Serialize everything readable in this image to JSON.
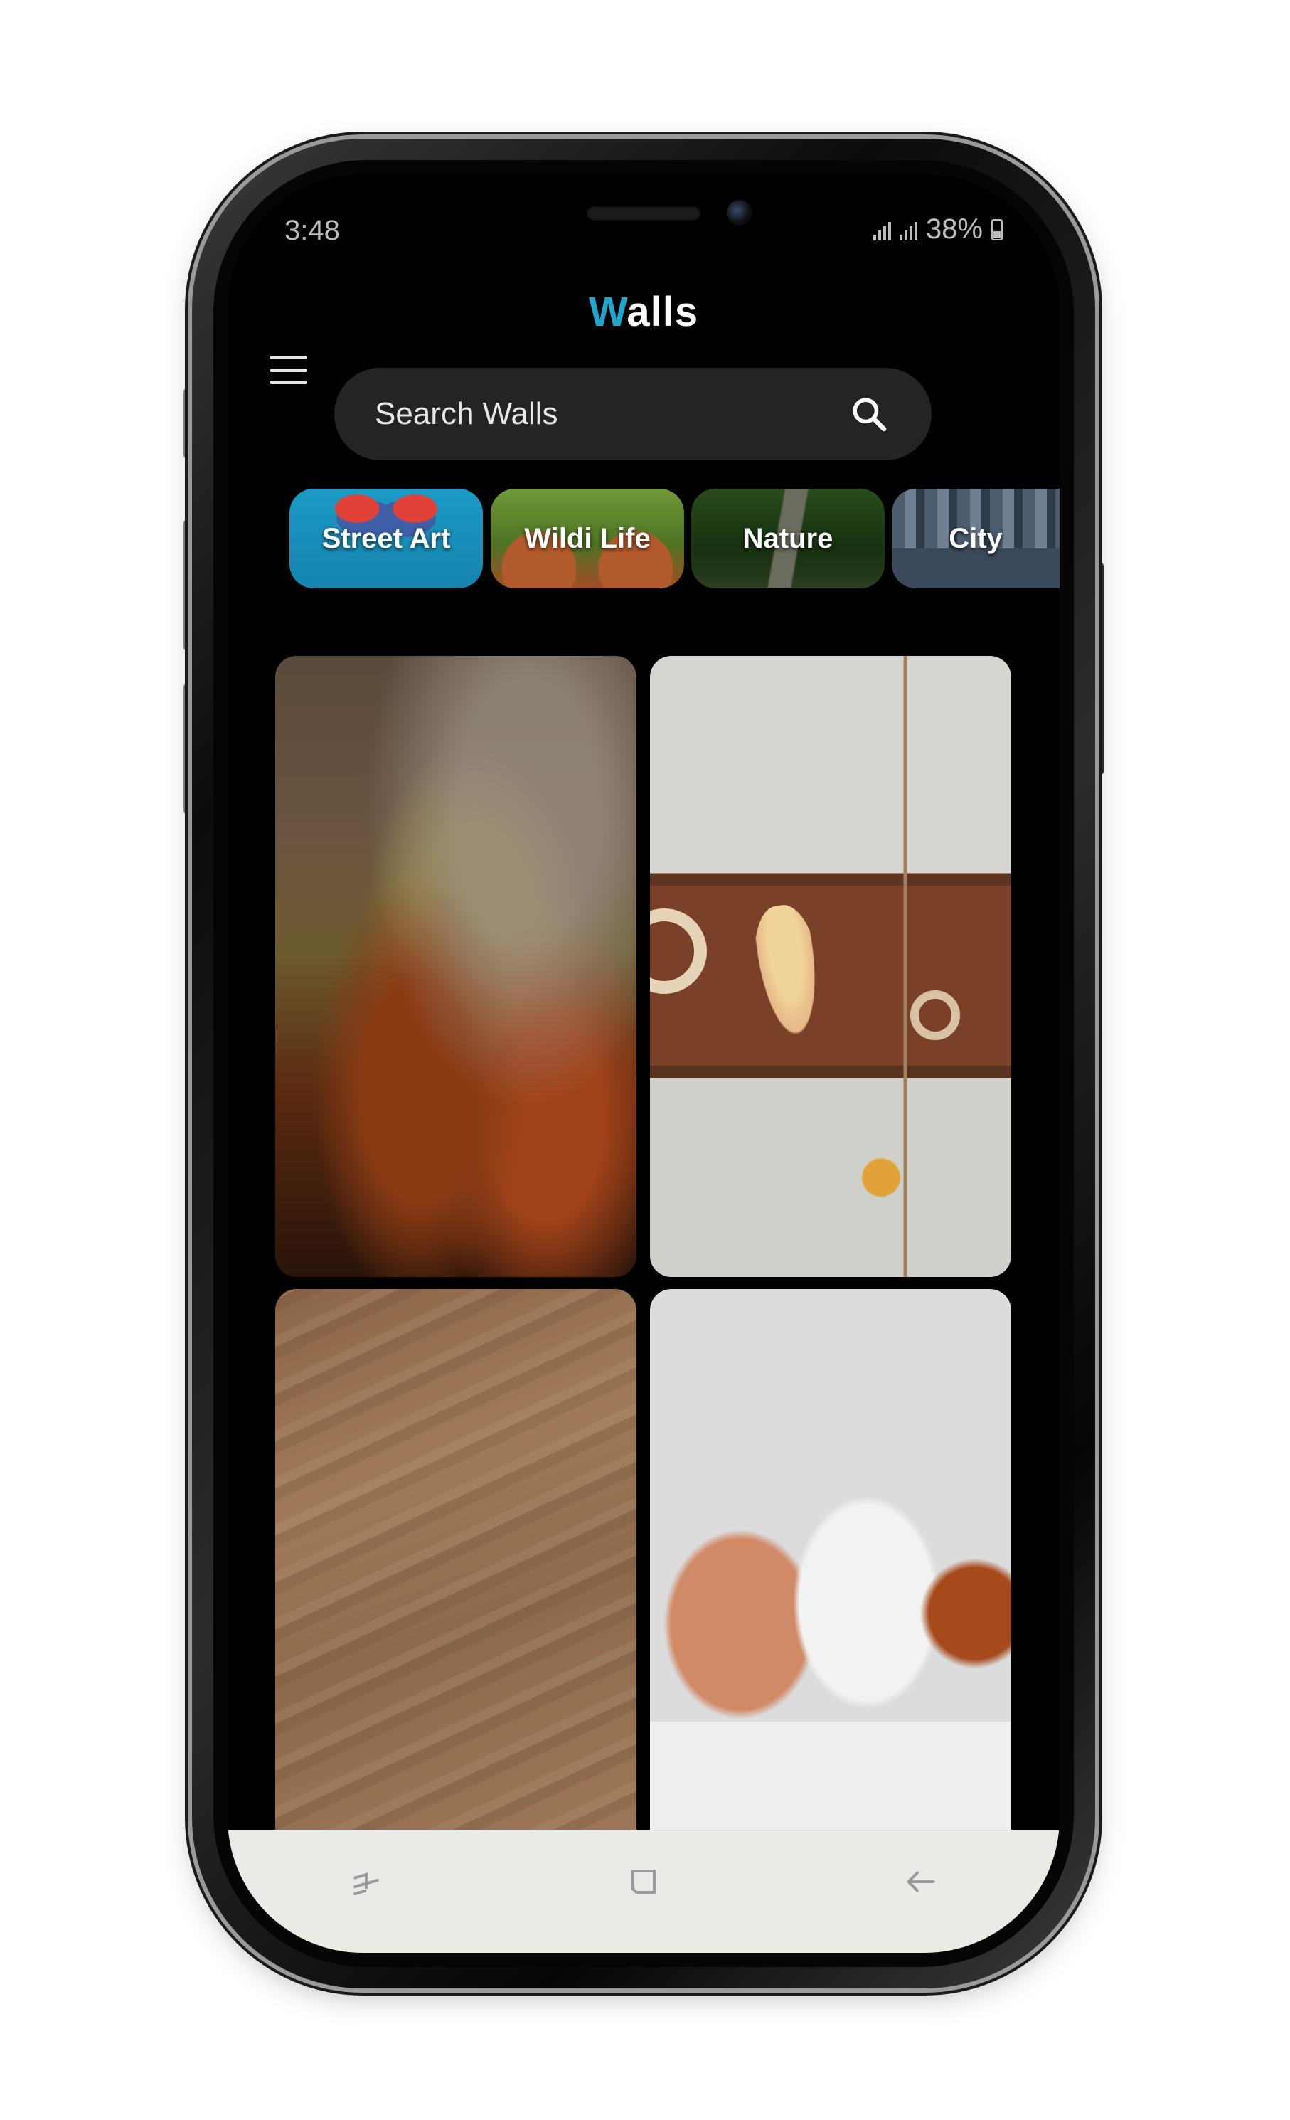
{
  "status_bar": {
    "time": "3:48",
    "battery": "38%",
    "icons": [
      "signal-icon",
      "signal-icon",
      "battery-icon"
    ]
  },
  "header": {
    "title_accent": "W",
    "title_rest": "alls",
    "accent_color": "#1fa6cf",
    "menu_icon": "menu-icon"
  },
  "search": {
    "placeholder": "Search Walls",
    "icon": "search-icon"
  },
  "categories": [
    {
      "label": "Street Art"
    },
    {
      "label": "Wildi Life"
    },
    {
      "label": "Nature"
    },
    {
      "label": "City"
    }
  ],
  "wallpapers": [
    {
      "subject": "autumn-forest"
    },
    {
      "subject": "flower-still-life"
    },
    {
      "subject": "sand-dune"
    },
    {
      "subject": "curled-up-person"
    }
  ],
  "nav_bar": {
    "icons": [
      "recents-icon",
      "home-icon",
      "back-icon"
    ]
  }
}
